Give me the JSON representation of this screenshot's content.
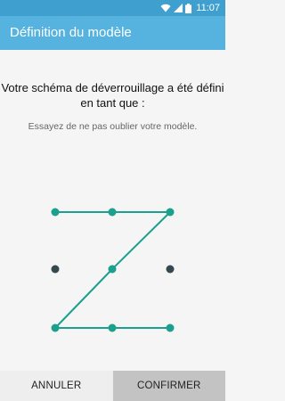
{
  "status_bar": {
    "time": "11:07",
    "icons": [
      "wifi-icon",
      "signal-icon",
      "battery-icon"
    ]
  },
  "app_bar": {
    "title": "Définition du modèle"
  },
  "message": {
    "line1": "Votre schéma de déverrouillage a été défini",
    "line2": "en tant que :",
    "hint": "Essayez de ne pas oublier votre modèle."
  },
  "pattern": {
    "grid_size": 3,
    "sequence": [
      1,
      2,
      3,
      5,
      7,
      8,
      9
    ],
    "line_color": "#1aa08c",
    "active_dot_color": "#1aa08c",
    "inactive_dot_color": "#37474f"
  },
  "buttons": {
    "cancel_label": "ANNULER",
    "confirm_label": "CONFIRMER"
  },
  "colors": {
    "status_bar": "#3f9fcf",
    "app_bar": "#56b3df"
  }
}
